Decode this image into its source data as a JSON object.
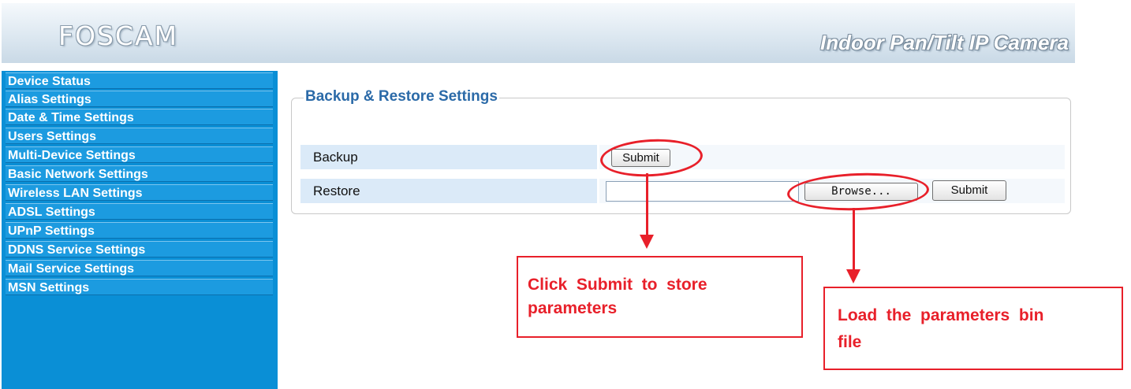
{
  "header": {
    "logo": "FOSCAM",
    "product": "Indoor Pan/Tilt IP Camera"
  },
  "sidebar": {
    "items": [
      {
        "label": "Device Status"
      },
      {
        "label": "Alias Settings"
      },
      {
        "label": "Date & Time Settings"
      },
      {
        "label": "Users Settings"
      },
      {
        "label": "Multi-Device Settings"
      },
      {
        "label": "Basic Network Settings"
      },
      {
        "label": "Wireless LAN Settings"
      },
      {
        "label": "ADSL Settings"
      },
      {
        "label": "UPnP Settings"
      },
      {
        "label": "DDNS Service Settings"
      },
      {
        "label": "Mail Service Settings"
      },
      {
        "label": "MSN Settings"
      }
    ]
  },
  "panel": {
    "title": "Backup & Restore Settings",
    "backup_label": "Backup",
    "backup_submit": "Submit",
    "restore_label": "Restore",
    "restore_file_value": "",
    "browse_label": "Browse...",
    "restore_submit": "Submit"
  },
  "annotations": {
    "callout1_line1": "Click  Submit  to  store",
    "callout1_line2": "parameters",
    "callout2_line1": "Load  the  parameters  bin",
    "callout2_line2": "file"
  },
  "colors": {
    "sidebar_bg": "#0a8fd6",
    "sidebar_item": "#1c9be0",
    "legend_text": "#2b6aa8",
    "annotation_red": "#e8202a",
    "row_label_bg": "#dbeaf8"
  }
}
